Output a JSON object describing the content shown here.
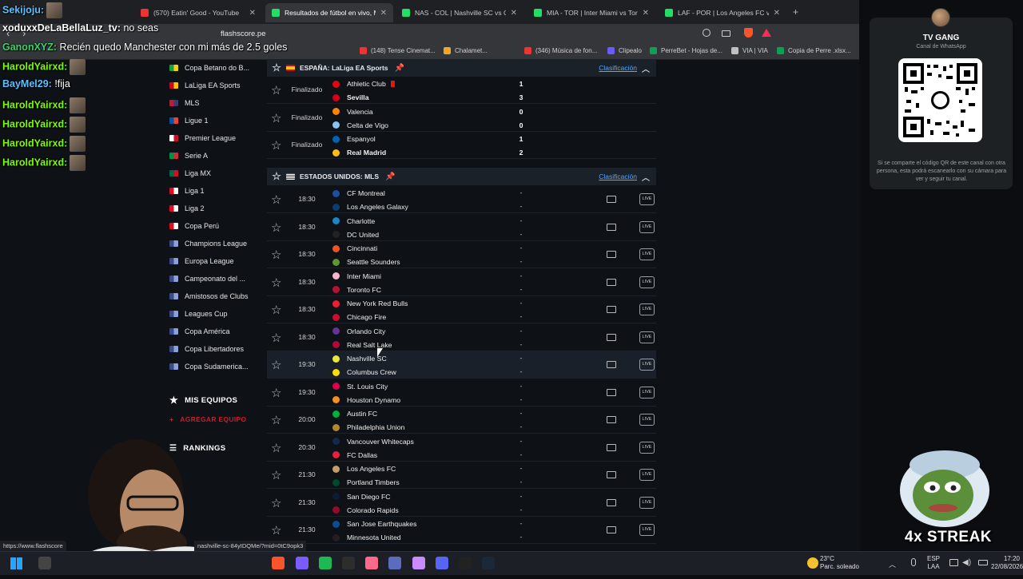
{
  "tabs": [
    {
      "title": "(570) Eatin' Good - YouTube",
      "color": "#e33",
      "active": false
    },
    {
      "title": "Resultados de fútbol en vivo, Ma",
      "color": "#2d6",
      "active": true
    },
    {
      "title": "NAS - COL | Nashville SC vs Columb",
      "color": "#2d6",
      "active": false
    },
    {
      "title": "MIA - TOR | Inter Miami vs Toronto F",
      "color": "#2d6",
      "active": false
    },
    {
      "title": "LAF - POR | Los Angeles FC vs Portla",
      "color": "#2d6",
      "active": false
    }
  ],
  "url": "flashscore.pe",
  "bookmarks": [
    {
      "label": "(148) Tense Cinemat...",
      "color": "#e33"
    },
    {
      "label": "Chalamet...",
      "color": "#f5a623"
    },
    {
      "label": "(346) Música de fon...",
      "color": "#e33"
    },
    {
      "label": "Clipealo",
      "color": "#6b5bff"
    },
    {
      "label": "PerreBet - Hojas de...",
      "color": "#0f9d58"
    },
    {
      "label": "VIA | VIA",
      "color": "#c0c0c0"
    },
    {
      "label": "Copia de Perre .xlsx...",
      "color": "#0f9d58"
    }
  ],
  "sidebar": {
    "items": [
      {
        "label": "Copa Betano do B...",
        "flag": [
          "#1b9e3e",
          "#f5d20a"
        ]
      },
      {
        "label": "LaLiga EA Sports",
        "flag": [
          "#c60b1e",
          "#ffc400"
        ]
      },
      {
        "label": "MLS",
        "flag": [
          "#b22234",
          "#3c3b6e"
        ]
      },
      {
        "label": "Ligue 1",
        "flag": [
          "#0055a4",
          "#ef4135"
        ]
      },
      {
        "label": "Premier League",
        "flag": [
          "#ffffff",
          "#ce1124"
        ]
      },
      {
        "label": "Serie A",
        "flag": [
          "#009246",
          "#ce2b37"
        ]
      },
      {
        "label": "Liga MX",
        "flag": [
          "#006847",
          "#ce1126"
        ]
      },
      {
        "label": "Liga 1",
        "flag": [
          "#d91023",
          "#ffffff"
        ]
      },
      {
        "label": "Liga 2",
        "flag": [
          "#d91023",
          "#ffffff"
        ]
      },
      {
        "label": "Copa Perú",
        "flag": [
          "#d91023",
          "#ffffff"
        ]
      },
      {
        "label": "Champions League",
        "flag": [
          "#3b4b8a",
          "#8fa0d8"
        ]
      },
      {
        "label": "Europa League",
        "flag": [
          "#3b4b8a",
          "#8fa0d8"
        ]
      },
      {
        "label": "Campeonato del ...",
        "flag": [
          "#3b4b8a",
          "#8fa0d8"
        ]
      },
      {
        "label": "Amistosos de Clubs",
        "flag": [
          "#3b4b8a",
          "#8fa0d8"
        ]
      },
      {
        "label": "Leagues Cup",
        "flag": [
          "#3b4b8a",
          "#8fa0d8"
        ]
      },
      {
        "label": "Copa América",
        "flag": [
          "#3b4b8a",
          "#8fa0d8"
        ]
      },
      {
        "label": "Copa Libertadores",
        "flag": [
          "#3b4b8a",
          "#8fa0d8"
        ]
      },
      {
        "label": "Copa Sudamerica...",
        "flag": [
          "#3b4b8a",
          "#8fa0d8"
        ]
      }
    ],
    "my_teams": "MIS EQUIPOS",
    "add_team": "AGREGAR EQUIPO",
    "rankings": "RANKINGS"
  },
  "laliga": {
    "title": "ESPAÑA: LaLiga EA Sports",
    "standings": "Clasificación",
    "matches": [
      {
        "status": "Finalizado",
        "home": "Athletic Club",
        "away": "Sevilla",
        "hs": "1",
        "as": "3",
        "winner": "away",
        "redcard": true
      },
      {
        "status": "Finalizado",
        "home": "Valencia",
        "away": "Celta de Vigo",
        "hs": "0",
        "as": "0",
        "winner": "none"
      },
      {
        "status": "Finalizado",
        "home": "Espanyol",
        "away": "Real Madrid",
        "hs": "1",
        "as": "2",
        "winner": "away"
      }
    ]
  },
  "mls": {
    "title": "ESTADOS UNIDOS: MLS",
    "standings": "Clasificación",
    "live_label": "LIVE",
    "matches": [
      {
        "time": "18:30",
        "home": "CF Montreal",
        "away": "Los Angeles Galaxy",
        "hc": "#1f4ea1",
        "ac": "#0f3b6e"
      },
      {
        "time": "18:30",
        "home": "Charlotte",
        "away": "DC United",
        "hc": "#1a85c8",
        "ac": "#222"
      },
      {
        "time": "18:30",
        "home": "Cincinnati",
        "away": "Seattle Sounders",
        "hc": "#f05323",
        "ac": "#5d9732"
      },
      {
        "time": "18:30",
        "home": "Inter Miami",
        "away": "Toronto FC",
        "hc": "#f7b5cd",
        "ac": "#b81137"
      },
      {
        "time": "18:30",
        "home": "New York Red Bulls",
        "away": "Chicago Fire",
        "hc": "#ed1e36",
        "ac": "#c8102e"
      },
      {
        "time": "18:30",
        "home": "Orlando City",
        "away": "Real Salt Lake",
        "hc": "#633492",
        "ac": "#b30838"
      },
      {
        "time": "19:30",
        "home": "Nashville SC",
        "away": "Columbus Crew",
        "hc": "#ece83a",
        "ac": "#fedd00",
        "hover": true
      },
      {
        "time": "19:30",
        "home": "St. Louis City",
        "away": "Houston Dynamo",
        "hc": "#dd004a",
        "ac": "#f4911e"
      },
      {
        "time": "20:00",
        "home": "Austin FC",
        "away": "Philadelphia Union",
        "hc": "#00b140",
        "ac": "#b1872d"
      },
      {
        "time": "20:30",
        "home": "Vancouver Whitecaps",
        "away": "FC Dallas",
        "hc": "#12284c",
        "ac": "#e81f3e"
      },
      {
        "time": "21:30",
        "home": "Los Angeles FC",
        "away": "Portland Timbers",
        "hc": "#c39e6d",
        "ac": "#00482b"
      },
      {
        "time": "21:30",
        "home": "San Diego FC",
        "away": "Colorado Rapids",
        "hc": "#0f1b33",
        "ac": "#960a2c"
      },
      {
        "time": "21:30",
        "home": "San Jose Earthquakes",
        "away": "Minnesota United",
        "hc": "#0d4c92",
        "ac": "#231f20"
      }
    ]
  },
  "whatsapp": {
    "title": "TV GANG",
    "subtitle": "Canal de WhatsApp",
    "desc": "Si se comparte el código QR de este canal con otra persona, esta podrá escanearlo con su cámara para ver y seguir tu canal."
  },
  "chat": [
    {
      "user": "Sekijoju:",
      "msg": "",
      "color": "#59c2ff",
      "avatar": true
    },
    {
      "user": "xoduxxDeLaBellaLuz_tv:",
      "msg": " no seas",
      "color": "#ffffff"
    },
    {
      "user": "GanonXYZ:",
      "msg": " Recién quedo Manchester con mi más de 2.5 goles",
      "color": "#3fd06b"
    },
    {
      "user": "HaroldYairxd:",
      "msg": "",
      "color": "#7cfc00",
      "avatar": true
    },
    {
      "user": "BayMel29:",
      "msg": " !fija",
      "color": "#59c2ff"
    },
    {
      "user": "HaroldYairxd:",
      "msg": "",
      "color": "#7cfc00",
      "avatar": true
    },
    {
      "user": "HaroldYairxd:",
      "msg": "",
      "color": "#7cfc00",
      "avatar": true
    },
    {
      "user": "HaroldYairxd:",
      "msg": "",
      "color": "#7cfc00",
      "avatar": true
    },
    {
      "user": "HaroldYairxd:",
      "msg": "",
      "color": "#7cfc00",
      "avatar": true
    }
  ],
  "streak": "4x STREAK",
  "status_url": "https://www.flashscore",
  "status_url2": "nashville-sc-84yIDQMe/?mid=0tC9opk3",
  "taskbar": {
    "temp": "23°C",
    "weather": "Parc. soleado",
    "lang1": "ESP",
    "lang2": "LAA",
    "time": "17:20",
    "date": "22/08/2026"
  }
}
